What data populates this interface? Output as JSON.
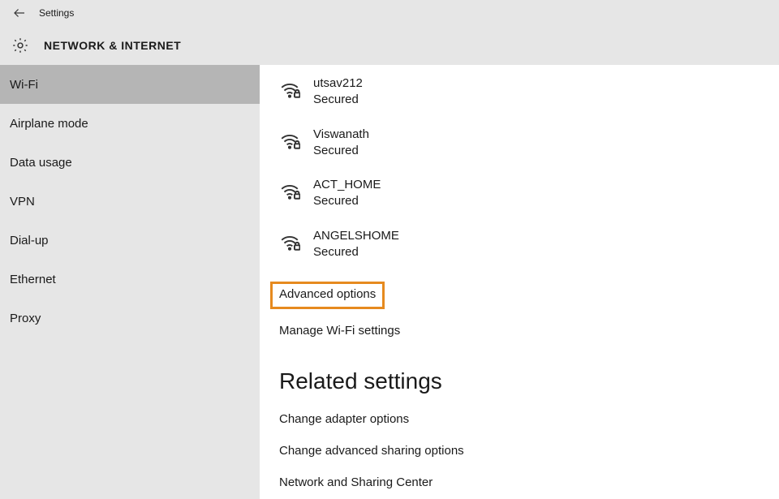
{
  "titlebar": {
    "title": "Settings"
  },
  "header": {
    "title": "NETWORK & INTERNET"
  },
  "sidebar": {
    "items": [
      {
        "label": "Wi-Fi",
        "active": true
      },
      {
        "label": "Airplane mode",
        "active": false
      },
      {
        "label": "Data usage",
        "active": false
      },
      {
        "label": "VPN",
        "active": false
      },
      {
        "label": "Dial-up",
        "active": false
      },
      {
        "label": "Ethernet",
        "active": false
      },
      {
        "label": "Proxy",
        "active": false
      }
    ]
  },
  "wifi": {
    "networks": [
      {
        "name": "utsav212",
        "status": "Secured"
      },
      {
        "name": "Viswanath",
        "status": "Secured"
      },
      {
        "name": "ACT_HOME",
        "status": "Secured"
      },
      {
        "name": "ANGELSHOME",
        "status": "Secured"
      }
    ],
    "advanced": "Advanced options",
    "manage": "Manage Wi-Fi settings"
  },
  "related": {
    "title": "Related settings",
    "links": [
      "Change adapter options",
      "Change advanced sharing options",
      "Network and Sharing Center"
    ]
  }
}
